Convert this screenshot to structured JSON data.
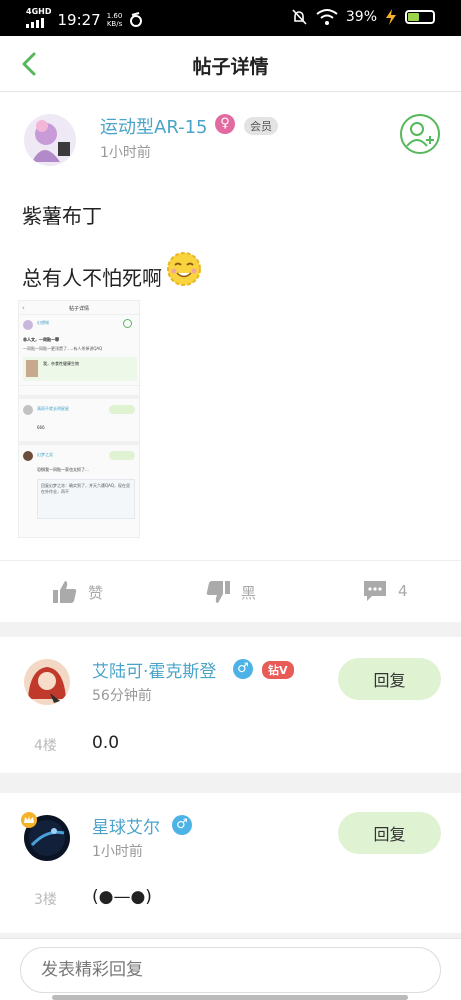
{
  "statusbar": {
    "network": "4G",
    "network_hd": "HD",
    "time": "19:27",
    "speed": "1.60",
    "speed_unit": "KB/s",
    "battery": "39%"
  },
  "nav": {
    "title": "帖子详情"
  },
  "post": {
    "author": "运动型AR-15",
    "member_badge": "会员",
    "time": "1小时前",
    "title": "紫薯布丁",
    "body": "总有人不怕死啊",
    "likes_label": "赞",
    "dislikes_label": "黑",
    "comments_count": "4",
    "embedded": {
      "nav_title": "帖子详情",
      "author": "幻想城",
      "post_title": "非人文，一同贴一罪",
      "post_text": "一同贴一同贴一更顶贯了.....有人杀掉讲QAQ",
      "link_title": "我，杂食性健康生物",
      "c1_name": "满雨不就长明星星",
      "c1_text": "666",
      "c2_name": "幻梦之尧",
      "c2_text": "恐惧我一同贴一家也太抓了...",
      "quote": "回复幻梦之冻：确实到了，并天六遭QAQ，现在显在外作业，再不"
    }
  },
  "comments": [
    {
      "name": "艾陆可·霍克斯登",
      "gender": "♂",
      "vip": "钻V",
      "time": "56分钟前",
      "floor": "4楼",
      "content": "0.0",
      "reply_label": "回复"
    },
    {
      "name": "星球艾尔",
      "gender": "♂",
      "time": "1小时前",
      "floor": "3楼",
      "content": "(●—●)",
      "reply_label": "回复"
    }
  ],
  "reply_bar": {
    "placeholder": "发表精彩回复"
  },
  "colors": {
    "accent_green": "#55b85a",
    "name_blue": "#4aa4c9",
    "reply_bg": "#dff3d3",
    "female_pink": "#e26aa0",
    "male_blue": "#4db3e6",
    "vip_red": "#e85b57"
  }
}
